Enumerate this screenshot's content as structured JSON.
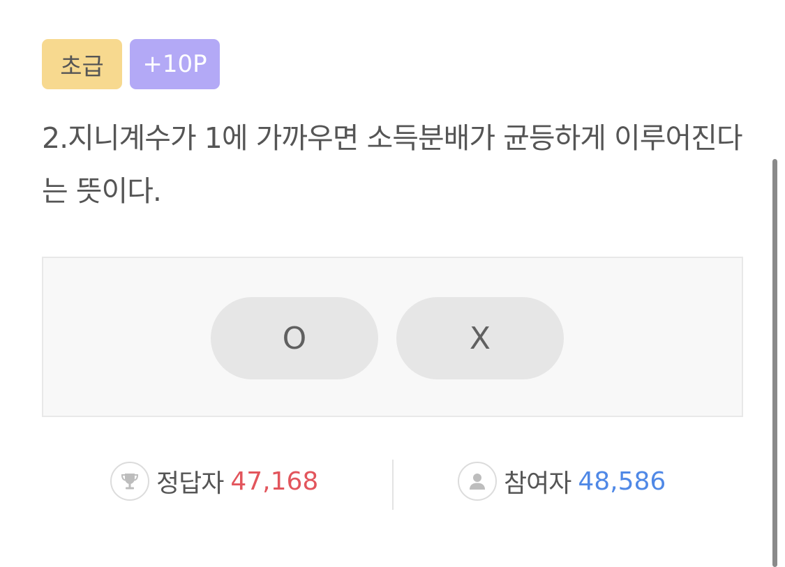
{
  "badges": {
    "level": "초급",
    "points": "+10P"
  },
  "question": {
    "text": "2.지니계수가 1에 가까우면 소득분배가 균등하게 이루어진다는 뜻이다."
  },
  "answers": {
    "o_label": "O",
    "x_label": "X"
  },
  "stats": {
    "correct_label": "정답자",
    "correct_value": "47,168",
    "participants_label": "참여자",
    "participants_value": "48,586"
  },
  "icons": {
    "correct": "trophy-icon",
    "participants": "user-icon"
  },
  "colors": {
    "level_badge": "#f7d98f",
    "points_badge": "#b3a9f6",
    "correct_value": "#e2555c",
    "participants_value": "#4f88e6"
  }
}
